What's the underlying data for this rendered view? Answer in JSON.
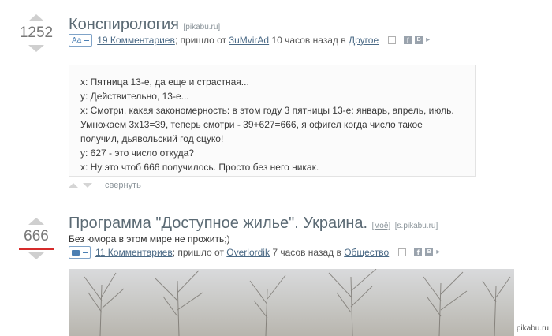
{
  "posts": [
    {
      "score": "1252",
      "title": "Конспирология",
      "source": "[pikabu.ru]",
      "type_label": "Aa",
      "comments": "19 Комментариев",
      "from_text": "; пришло от",
      "author": "3uMvirAd",
      "time_text": "10 часов назад в",
      "category": "Другое",
      "story_lines": [
        "x: Пятница 13-е, да еще и страстная...",
        "y: Действительно, 13-е...",
        "x: Смотри, какая закономерность: в этом году 3 пятницы 13-е: январь, апрель, июль.",
        "Умножаем 3x13=39, теперь смотри - 39+627=666, я офигел когда число такое",
        "получил, дьявольский год сцуко!",
        "y: 627 - это число откуда?",
        "x: Ну это чтоб 666 получилось. Просто без него никак."
      ],
      "collapse_label": "свернуть"
    },
    {
      "score": "666",
      "title": "Программа \"Доступное жилье\". Украина.",
      "my_label": "[моё]",
      "source": "[s.pikabu.ru]",
      "description": "Без юмора в этом мире не прожить;)",
      "type_label": "camera",
      "comments": "11 Комментариев",
      "from_text": "; пришло от",
      "author": "Overlordik",
      "time_text": "7 часов назад в",
      "category": "Общество"
    }
  ],
  "icons": {
    "save": "save-icon",
    "facebook": "f",
    "vk": "B",
    "twitter": "twitter-icon"
  },
  "watermark": "pikabu.ru"
}
